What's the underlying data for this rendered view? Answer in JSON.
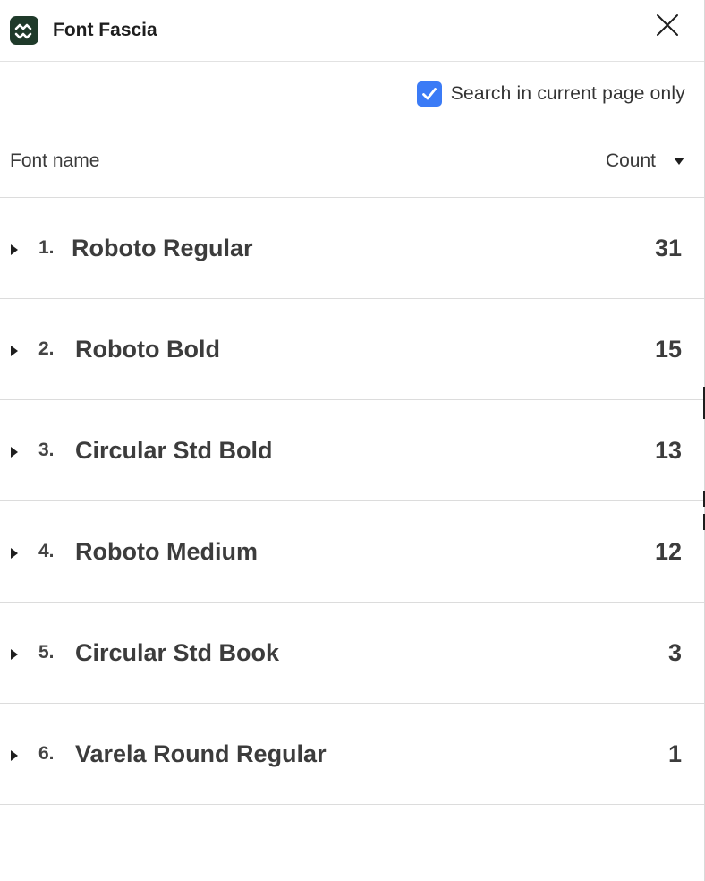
{
  "app": {
    "title": "Font Fascia"
  },
  "toolbar": {
    "checkbox_checked": true,
    "checkbox_label": "Search in current page only",
    "accent": "#3b7bf6"
  },
  "columns": {
    "name": "Font name",
    "count": "Count",
    "sort": "descending"
  },
  "fonts": [
    {
      "rank": "1.",
      "name": "Roboto Regular",
      "count": "31"
    },
    {
      "rank": "2.",
      "name": "Roboto Bold",
      "count": "15"
    },
    {
      "rank": "3.",
      "name": "Circular Std Bold",
      "count": "13"
    },
    {
      "rank": "4.",
      "name": "Roboto Medium",
      "count": "12"
    },
    {
      "rank": "5.",
      "name": "Circular Std Book",
      "count": "3"
    },
    {
      "rank": "6.",
      "name": "Varela Round Regular",
      "count": "1"
    }
  ],
  "icons": {
    "logo": "app-logo-icon",
    "close": "close-icon",
    "checkbox": "checkmark-icon",
    "sort": "sort-down-icon",
    "expand": "expand-caret-icon"
  }
}
